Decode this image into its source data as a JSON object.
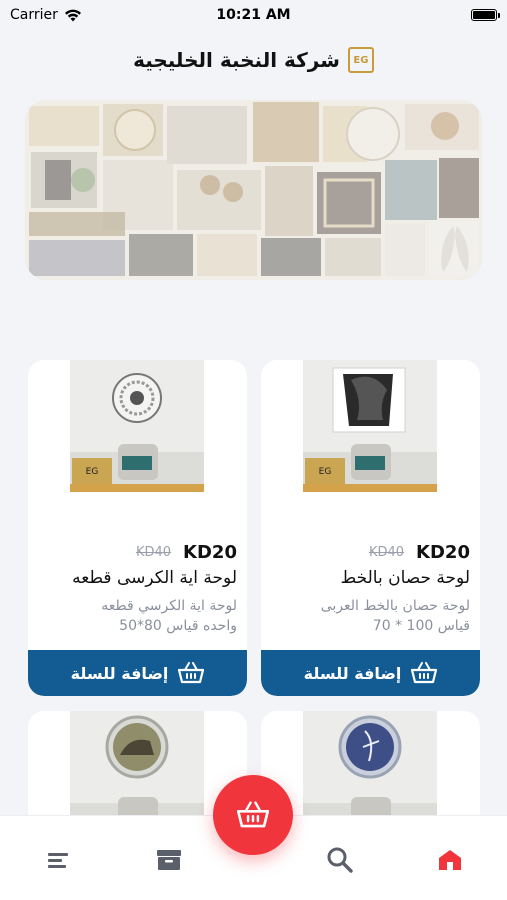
{
  "status": {
    "carrier": "Carrier",
    "time": "10:21 AM"
  },
  "header": {
    "title": "شركة النخبة الخليجية",
    "logo_text": "EG",
    "brand_color": "#c79b3b"
  },
  "products": [
    {
      "price_new": "KD20",
      "price_old": "KD40",
      "title": "لوحة حصان بالخط",
      "desc_line1": "لوحة حصان بالخط العربى",
      "desc_line2": "قياس 100 * 70",
      "button_label": "إضافة للسلة"
    },
    {
      "price_new": "KD20",
      "price_old": "KD40",
      "title": "لوحة اية الكرسى قطعه",
      "desc_line1": "لوحة اية الكرسي قطعه",
      "desc_line2": "واحده قياس 80*50",
      "button_label": "إضافة للسلة"
    }
  ],
  "nav": {
    "items": [
      "menu-icon",
      "archive-icon",
      "search-icon",
      "home-icon"
    ],
    "fab_icon": "basket-icon",
    "accent_color": "#f0353c",
    "button_color": "#125c93"
  }
}
